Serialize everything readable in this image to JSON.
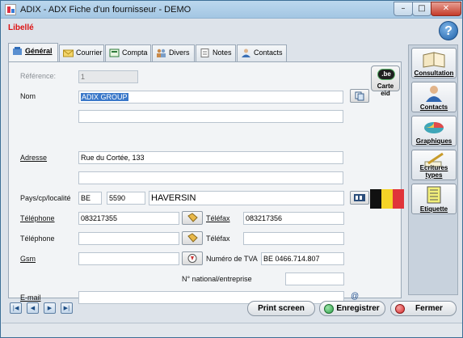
{
  "window": {
    "title": "ADIX - ADX  Fiche d'un fournisseur - DEMO",
    "minimize": "–",
    "maximize": "□",
    "close": "✕"
  },
  "header": {
    "libelle": "Libellé",
    "help": "?"
  },
  "tabs": [
    {
      "label": "Général",
      "icon": "general-icon"
    },
    {
      "label": "Courrier",
      "icon": "envelope-icon"
    },
    {
      "label": "Compta",
      "icon": "accounting-icon"
    },
    {
      "label": "Divers",
      "icon": "people-icon"
    },
    {
      "label": "Notes",
      "icon": "notes-icon"
    },
    {
      "label": "Contacts",
      "icon": "contacts-icon"
    }
  ],
  "form": {
    "reference_label": "Référence:",
    "reference_value": "1",
    "nom_label": "Nom",
    "nom_value": "ADIX GROUP",
    "nom2_value": "",
    "adresse_label": "Adresse",
    "adresse_value": "Rue du Cortée, 133",
    "adresse2_value": "",
    "pays_label": "Pays/cp/localité",
    "pays_value": "BE",
    "cp_value": "5590",
    "localite_value": "HAVERSIN",
    "telephone1_label": "Téléphone",
    "telephone1_value": "083217355",
    "telefax1_label": "Téléfax",
    "telefax1_value": "083217356",
    "telephone2_label": "Téléphone",
    "telephone2_value": "",
    "telefax2_label": "Téléfax",
    "telefax2_value": "",
    "gsm_label": "Gsm",
    "gsm_value": "",
    "tva_label": "Numéro de TVA",
    "tva_value": "BE 0466.714.807",
    "national_label": "N° national/entreprise",
    "national_value": "",
    "email_label": "E-mail",
    "email_value": "",
    "carte_eid_label": "Carte eid",
    "carte_eid_badge": ".be"
  },
  "sidebar": [
    {
      "label": "Consultation",
      "icon": "book-icon"
    },
    {
      "label": "Contacts",
      "icon": "person-icon"
    },
    {
      "label": "Graphiques",
      "icon": "pie-chart-icon"
    },
    {
      "label": "Ecritures types",
      "icon": "pen-icon"
    },
    {
      "label": "Etiquette",
      "icon": "label-sheet-icon"
    }
  ],
  "footer": {
    "nav": [
      "|◀",
      "◀",
      "▶",
      "▶|"
    ],
    "print_label": "Print screen",
    "save_label": "Enregistrer",
    "close_label": "Fermer"
  },
  "colors": {
    "libelle": "#dd1111",
    "selection": "#3a78c9",
    "save_dot": "#2fa34a",
    "close_dot": "#d92a2a"
  }
}
